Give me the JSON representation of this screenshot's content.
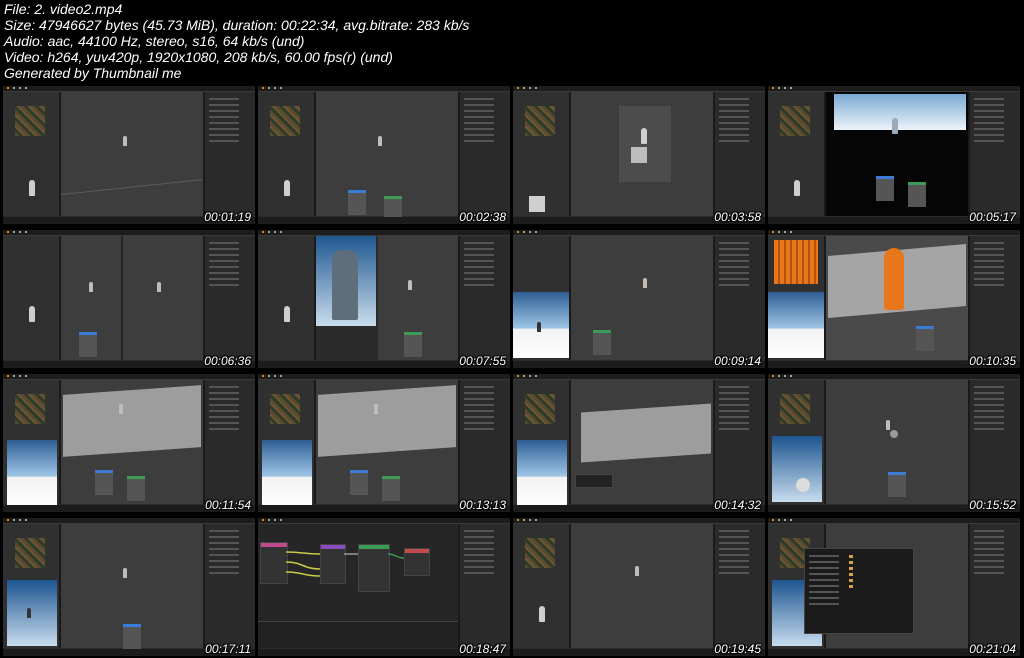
{
  "header": {
    "line1": "File: 2. video2.mp4",
    "line2": "Size: 47946627 bytes (45.73 MiB), duration: 00:22:34, avg.bitrate: 283 kb/s",
    "line3": "Audio: aac, 44100 Hz, stereo, s16, 64 kb/s (und)",
    "line4": "Video: h264, yuv420p, 1920x1080, 208 kb/s, 60.00 fps(r) (und)",
    "line5": "Generated by Thumbnail me"
  },
  "thumbnails": [
    {
      "timestamp": "00:01:19"
    },
    {
      "timestamp": "00:02:38"
    },
    {
      "timestamp": "00:03:58"
    },
    {
      "timestamp": "00:05:17"
    },
    {
      "timestamp": "00:06:36"
    },
    {
      "timestamp": "00:07:55"
    },
    {
      "timestamp": "00:09:14"
    },
    {
      "timestamp": "00:10:35"
    },
    {
      "timestamp": "00:11:54"
    },
    {
      "timestamp": "00:13:13"
    },
    {
      "timestamp": "00:14:32"
    },
    {
      "timestamp": "00:15:52"
    },
    {
      "timestamp": "00:17:11"
    },
    {
      "timestamp": "00:18:47"
    },
    {
      "timestamp": "00:19:45"
    },
    {
      "timestamp": "00:21:04"
    }
  ],
  "colors": {
    "background": "#000000",
    "text": "#ffffff",
    "blender_accent": "#e87d0d",
    "sky": "#9fc6e6",
    "orange_material": "#e8761a"
  }
}
